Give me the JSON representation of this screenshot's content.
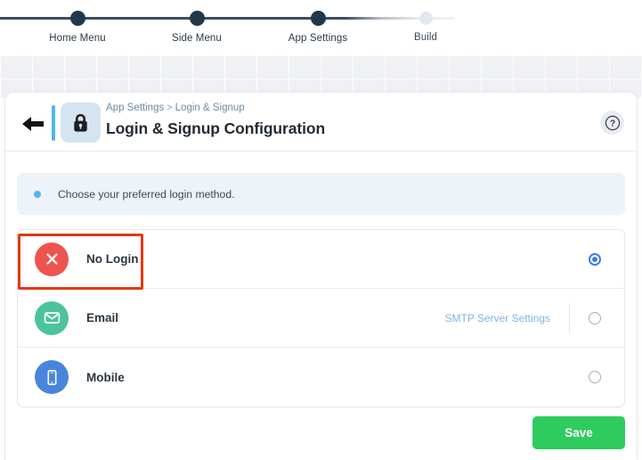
{
  "stepper": {
    "steps": [
      {
        "label": "Home Menu",
        "state": "done"
      },
      {
        "label": "Side Menu",
        "state": "done"
      },
      {
        "label": "App Settings",
        "state": "done"
      },
      {
        "label": "Build",
        "state": "pending"
      }
    ]
  },
  "header": {
    "back_icon": "arrow-left-icon",
    "badge_icon": "lock-icon",
    "breadcrumb_parent": "App Settings",
    "breadcrumb_separator": ">",
    "breadcrumb_current": "Login & Signup",
    "title": "Login & Signup Configuration",
    "help_icon": "question-mark-icon",
    "help_label": "?"
  },
  "banner": {
    "icon": "bullet-dot-icon",
    "text": "Choose your preferred login method."
  },
  "options": [
    {
      "id": "no-login",
      "label": "No Login",
      "icon": "close-circle-icon",
      "icon_color": "#ef5350",
      "link": null,
      "selected": true
    },
    {
      "id": "email",
      "label": "Email",
      "icon": "envelope-icon",
      "icon_color": "#4cc49a",
      "link": "SMTP Server Settings",
      "selected": false
    },
    {
      "id": "mobile",
      "label": "Mobile",
      "icon": "smartphone-icon",
      "icon_color": "#4a85dd",
      "link": null,
      "selected": false
    }
  ],
  "footer": {
    "save_label": "Save"
  },
  "annotation": {
    "color": "#e03a10",
    "target": "no-login-option"
  },
  "colors": {
    "accent_blue": "#4cb4ef",
    "radio_selected": "#3a7bed",
    "save_green": "#2ecc5e",
    "step_done": "#22384a",
    "step_pending": "#e3e8f0",
    "link_blue": "#7fb4e4"
  }
}
